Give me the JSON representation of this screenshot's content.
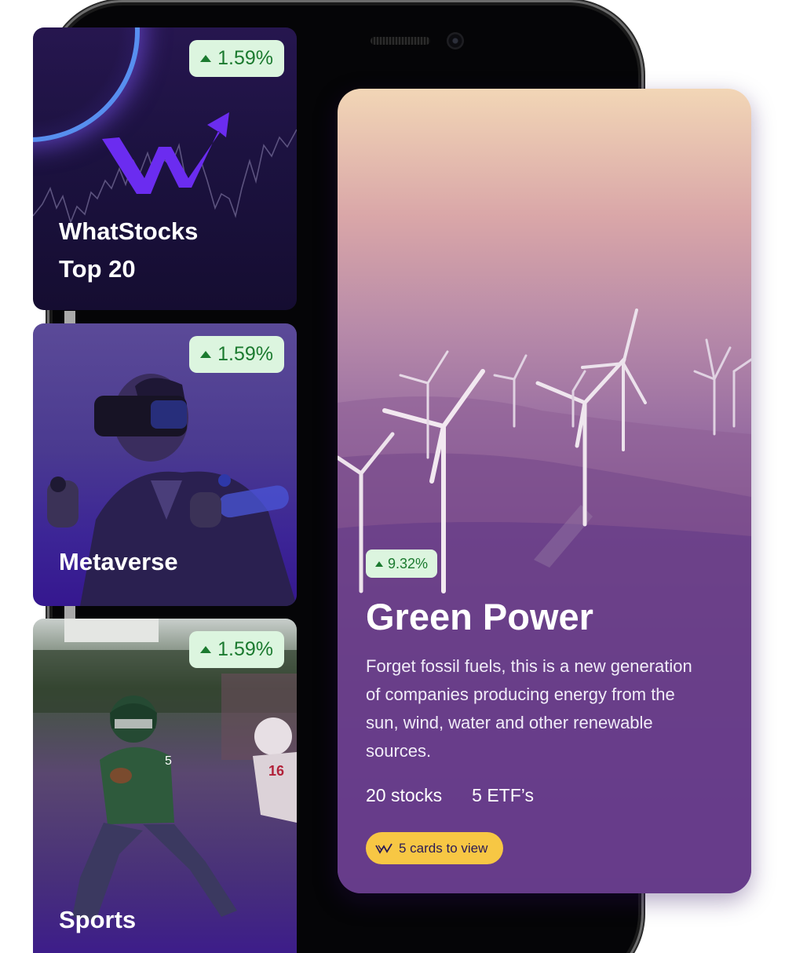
{
  "cards": [
    {
      "title_line1": "WhatStocks",
      "title_line2": "Top 20",
      "change": "1.59%",
      "image": "stock-chart-logo"
    },
    {
      "title": "Metaverse",
      "change": "1.59%",
      "image": "vr-headset-person-photo"
    },
    {
      "title": "Sports",
      "change": "1.59%",
      "image": "american-football-player-photo"
    }
  ],
  "featured": {
    "change": "9.32%",
    "title": "Green Power",
    "description": "Forget fossil fuels, this is a new generation of companies producing energy from the sun, wind, water and other renewable sources.",
    "stocks": "20 stocks",
    "etfs": "5 ETF’s",
    "cta_label": "5 cards to view",
    "cta_icon": "whatstocks-w-icon",
    "image": "wind-turbines-photo"
  },
  "colors": {
    "positive_bg": "#dcf5df",
    "positive_text": "#1b7a2f",
    "cta": "#f7c744",
    "brand_purple": "#3c1292"
  }
}
